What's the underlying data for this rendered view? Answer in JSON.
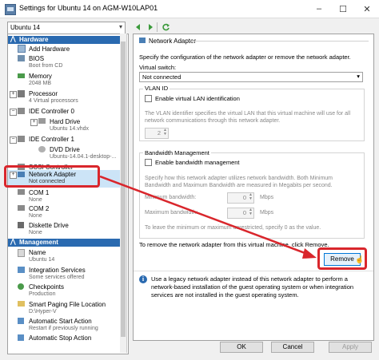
{
  "window": {
    "title": "Settings for Ubuntu 14 on AGM-W10LAP01",
    "minimize": "–",
    "maximize": "☐",
    "close": "✕"
  },
  "vm_selector": {
    "value": "Ubuntu 14"
  },
  "sidebar": {
    "hardware_header": "Hardware",
    "management_header": "Management",
    "hardware_items": [
      {
        "name": "Add Hardware",
        "sub": ""
      },
      {
        "name": "BIOS",
        "sub": "Boot from CD"
      },
      {
        "name": "Memory",
        "sub": "2048 MB"
      },
      {
        "name": "Processor",
        "sub": "4 Virtual processors"
      },
      {
        "name": "IDE Controller 0",
        "sub": ""
      },
      {
        "name": "Hard Drive",
        "sub": "Ubuntu 14.vhdx"
      },
      {
        "name": "IDE Controller 1",
        "sub": ""
      },
      {
        "name": "DVD Drive",
        "sub": "Ubuntu-14.04.1-desktop-..."
      },
      {
        "name": "SCSI Controller",
        "sub": ""
      },
      {
        "name": "Network Adapter",
        "sub": "Not connected"
      },
      {
        "name": "COM 1",
        "sub": "None"
      },
      {
        "name": "COM 2",
        "sub": "None"
      },
      {
        "name": "Diskette Drive",
        "sub": "None"
      }
    ],
    "management_items": [
      {
        "name": "Name",
        "sub": "Ubuntu 14"
      },
      {
        "name": "Integration Services",
        "sub": "Some services offered"
      },
      {
        "name": "Checkpoints",
        "sub": "Production"
      },
      {
        "name": "Smart Paging File Location",
        "sub": "D:\\Hyper-V"
      },
      {
        "name": "Automatic Start Action",
        "sub": "Restart if previously running"
      },
      {
        "name": "Automatic Stop Action",
        "sub": ""
      }
    ]
  },
  "panel": {
    "title": "Network Adapter",
    "description": "Specify the configuration of the network adapter or remove the network adapter.",
    "virtual_switch_label": "Virtual switch:",
    "virtual_switch_value": "Not connected",
    "vlan_group": "VLAN ID",
    "vlan_checkbox": "Enable virtual LAN identification",
    "vlan_desc_1": "The VLAN identifier specifies the virtual LAN that this virtual machine will use for all",
    "vlan_desc_2": "network communications through this network adapter.",
    "vlan_value": "2",
    "bw_group": "Bandwidth Management",
    "bw_checkbox": "Enable bandwidth management",
    "bw_desc_1": "Specify how this network adapter utilizes network bandwidth. Both Minimum",
    "bw_desc_2": "Bandwidth and Maximum Bandwidth are measured in Megabits per second.",
    "min_label": "Minimum bandwidth:",
    "max_label": "Maximum bandwidth:",
    "min_value": "0",
    "max_value": "0",
    "unit": "Mbps",
    "bw_note_1": "To leave the minimum or maximum unrestricted, specify 0 as the value.",
    "remove_text": "To remove the network adapter from this virtual machine, click Remove.",
    "remove_button": "Remove",
    "info_1": "Use a legacy network adapter instead of this network adapter to perform a",
    "info_2": "network-based installation of the guest operating system or when integration",
    "info_3": "services are not installed in the guest operating system."
  },
  "footer": {
    "ok": "OK",
    "cancel": "Cancel",
    "apply": "Apply"
  },
  "colors": {
    "selection": "#cce4f7",
    "section_header": "#2a6ab0",
    "annotation": "#d9262c"
  }
}
